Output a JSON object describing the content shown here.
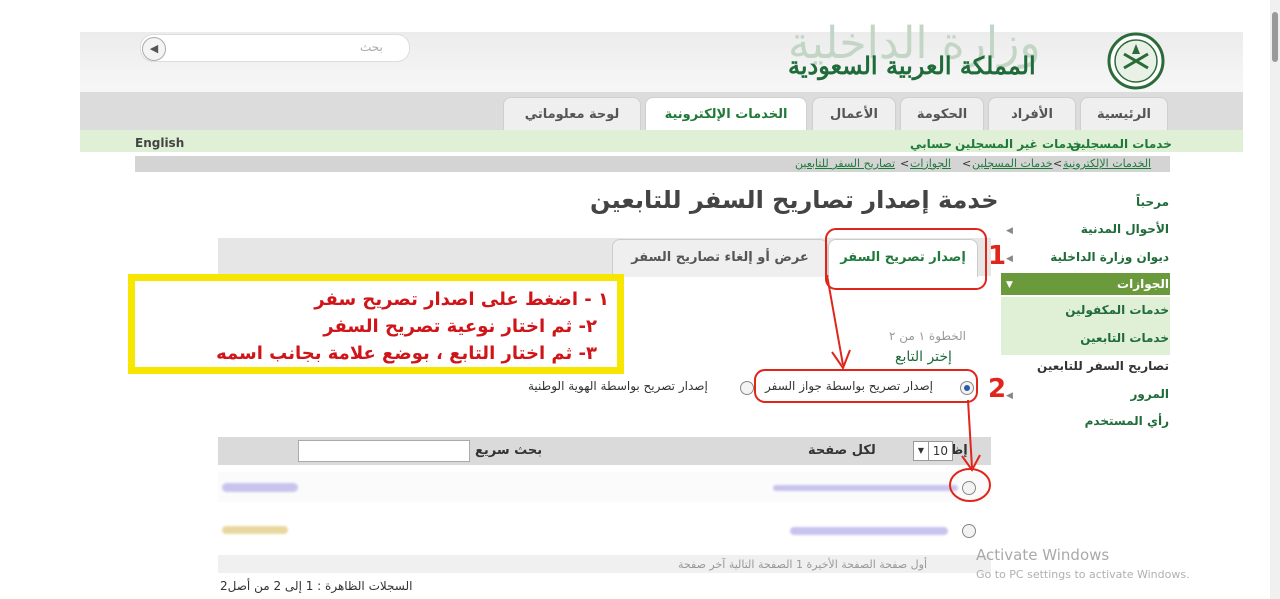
{
  "header": {
    "search_placeholder": "بحث",
    "ministry_name": "وزارة الداخلية",
    "kingdom_name": "المملكة العربية السعودية"
  },
  "nav": {
    "tabs": [
      "الرئيسية",
      "الأفراد",
      "الحكومة",
      "الأعمال",
      "الخدمات الإلكترونية",
      "لوحة معلوماتي"
    ],
    "active_tab": "الخدمات الإلكترونية"
  },
  "subnav": {
    "english": "English",
    "links": [
      "خدمات المسجلين",
      "خدمات غير المسجلين",
      "حسابي"
    ]
  },
  "breadcrumb": [
    "الخدمات الإلكترونية",
    "خدمات المسجلين",
    "الجوازات",
    "تصاريح السفر للتابعين"
  ],
  "sidebar": {
    "items": [
      {
        "label": "مرحباً"
      },
      {
        "label": "الأحوال المدنية"
      },
      {
        "label": "ديوان وزارة الداخلية"
      },
      {
        "label": "الجوازات"
      },
      {
        "label": "خدمات المكفولين"
      },
      {
        "label": "خدمات التابعين"
      },
      {
        "label": "تصاريح السفر للتابعين"
      },
      {
        "label": "المرور"
      },
      {
        "label": "رأي المستخدم"
      }
    ]
  },
  "main": {
    "page_title": "خدمة إصدار تصاريح السفر للتابعين",
    "tabs": [
      "إصدار تصريح السفر",
      "عرض أو إلغاء تصاريح السفر"
    ],
    "step": "الخطوة ١ من ٢",
    "choose": "إختر التابع",
    "radio_passport": "إصدار تصريح بواسطة جواز السفر",
    "radio_national_id": "إصدار تصريح بواسطة الهوية الوطنية",
    "show_label": "إظهار",
    "page_size": "10",
    "per_page_label": "لكل صفحة",
    "quick_search_label": "بحث سريع",
    "pager": "أول صفحة الصفحة الأخيرة 1 الصفحة التالية آخر صفحة",
    "records": "السجلات الظاهرة : 1 إلى 2 من أصل2"
  },
  "annotation": {
    "lines": [
      "١ - اضغط على اصدار تصريح سفر",
      "٢- ثم اختار نوعية تصريح السفر",
      "٣- ثم اختار التابع ، بوضع علامة بجانب اسمه"
    ],
    "numbers": [
      "1",
      "2"
    ]
  },
  "watermark": {
    "line1": "Activate Windows",
    "line2": "Go to PC settings to activate Windows."
  },
  "colors": {
    "brand_green": "#1f6b3a",
    "annotation_red": "#e0251b",
    "annotation_yellow": "#f7e600",
    "active_tab": "#1f7a3a"
  }
}
